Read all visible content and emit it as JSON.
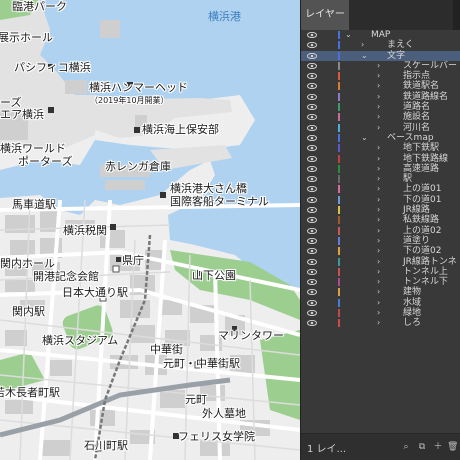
{
  "map": {
    "labels": {
      "rinko_park": "臨港パーク",
      "yokohama_port": "横浜港",
      "tenji_hall": "展示ホール",
      "pacifico": "パシフィコ横浜",
      "hammerhead": "横浜ハンマーヘッド",
      "hammerhead_note": "（2019年10月開業）",
      "ages": "ーズ",
      "air_yokohama": "エア横浜",
      "coastguard": "横浜海上保安部",
      "world_porters_1": "横浜ワールド",
      "world_porters_2": "ポーターズ",
      "red_brick": "赤レンガ倉庫",
      "osanbashi_1": "横浜港大さん橋",
      "osanbashi_2": "国際客船ターミナル",
      "bashamichi": "馬車道駅",
      "customs": "横浜税関",
      "kencho_st": "県庁",
      "prefecture": "県庁",
      "kaiko_kinenkan": "開港記念会館",
      "nihon_odori": "日本大通り駅",
      "yamashita_park": "山下公園",
      "kannai": "関内駅",
      "marine_tower": "マリンタワー",
      "stadium": "横浜スタジアム",
      "chinatown": "中華街",
      "motomachi_chukagai": "元町・中華街駅",
      "koganecho": "若木長者町駅",
      "motomachi": "元町",
      "foreign_cemetery": "外人墓地",
      "ishikawacho": "石川町駅",
      "ferris": "フェリス女学院",
      "kannai_ken": "関内ホール"
    }
  },
  "panel": {
    "tab_label": "レイヤー",
    "footer_count": "1 レイ...",
    "layers": [
      {
        "name": "MAP",
        "depth": 0,
        "expanded": true,
        "color": "#4a6fe0",
        "selected": false
      },
      {
        "name": "まえく",
        "depth": 1,
        "expanded": false,
        "color": "#4a6fe0",
        "selected": false
      },
      {
        "name": "文字",
        "depth": 1,
        "expanded": true,
        "color": "#4a6fe0",
        "selected": true
      },
      {
        "name": "スケールバー",
        "depth": 2,
        "expanded": false,
        "color": "#8a8a8a",
        "selected": false
      },
      {
        "name": "指示点",
        "depth": 2,
        "expanded": false,
        "color": "#d85a3a",
        "selected": false
      },
      {
        "name": "鉄道駅名",
        "depth": 2,
        "expanded": false,
        "color": "#e07a2a",
        "selected": false
      },
      {
        "name": "鉄道路線名",
        "depth": 2,
        "expanded": false,
        "color": "#8f7ac8",
        "selected": false
      },
      {
        "name": "道路名",
        "depth": 2,
        "expanded": false,
        "color": "#3c9c6a",
        "selected": false
      },
      {
        "name": "施設名",
        "depth": 2,
        "expanded": false,
        "color": "#c76a9d",
        "selected": false
      },
      {
        "name": "河川名",
        "depth": 2,
        "expanded": false,
        "color": "#4ab0d8",
        "selected": false
      },
      {
        "name": "ベースmap",
        "depth": 1,
        "expanded": true,
        "color": "#4a6fe0",
        "selected": false
      },
      {
        "name": "地下鉄駅",
        "depth": 2,
        "expanded": false,
        "color": "#5a5ad0",
        "selected": false
      },
      {
        "name": "地下鉄路線",
        "depth": 2,
        "expanded": false,
        "color": "#c04040",
        "selected": false
      },
      {
        "name": "高速道路",
        "depth": 2,
        "expanded": false,
        "color": "#2a8f3a",
        "selected": false
      },
      {
        "name": "駅",
        "depth": 2,
        "expanded": false,
        "color": "#6a6a6a",
        "selected": false
      },
      {
        "name": "上の道01",
        "depth": 2,
        "expanded": false,
        "color": "#d86aa0",
        "selected": false
      },
      {
        "name": "下の道01",
        "depth": 2,
        "expanded": false,
        "color": "#6a9ad8",
        "selected": false
      },
      {
        "name": "JR線路",
        "depth": 2,
        "expanded": false,
        "color": "#d8c04a",
        "selected": false
      },
      {
        "name": "私鉄線路",
        "depth": 2,
        "expanded": false,
        "color": "#a05a2a",
        "selected": false
      },
      {
        "name": "上の道02",
        "depth": 2,
        "expanded": false,
        "color": "#c8585a",
        "selected": false
      },
      {
        "name": "道塗り",
        "depth": 2,
        "expanded": false,
        "color": "#6a7ad8",
        "selected": false
      },
      {
        "name": "下の道02",
        "depth": 2,
        "expanded": false,
        "color": "#e0a040",
        "selected": false
      },
      {
        "name": "JR線路トンネ",
        "depth": 2,
        "expanded": false,
        "color": "#3a9a9a",
        "selected": false
      },
      {
        "name": "トンネル上",
        "depth": 2,
        "expanded": false,
        "color": "#d05050",
        "selected": false
      },
      {
        "name": "トンネル下",
        "depth": 2,
        "expanded": false,
        "color": "#b04a8a",
        "selected": false
      },
      {
        "name": "建物",
        "depth": 2,
        "expanded": false,
        "color": "#d8a040",
        "selected": false
      },
      {
        "name": "水域",
        "depth": 2,
        "expanded": false,
        "color": "#4a7ad8",
        "selected": false
      },
      {
        "name": "緑地",
        "depth": 2,
        "expanded": false,
        "color": "#c04a4a",
        "selected": false
      },
      {
        "name": "しろ",
        "depth": 2,
        "expanded": false,
        "color": "#d04a4a",
        "selected": false
      }
    ]
  },
  "colors": {
    "water": "#aed2ef",
    "land": "#eeeeee",
    "green": "#9ccf8f",
    "building": "#cfcfcf",
    "road": "#ffffff",
    "selected_row": "#4b5f7d"
  }
}
